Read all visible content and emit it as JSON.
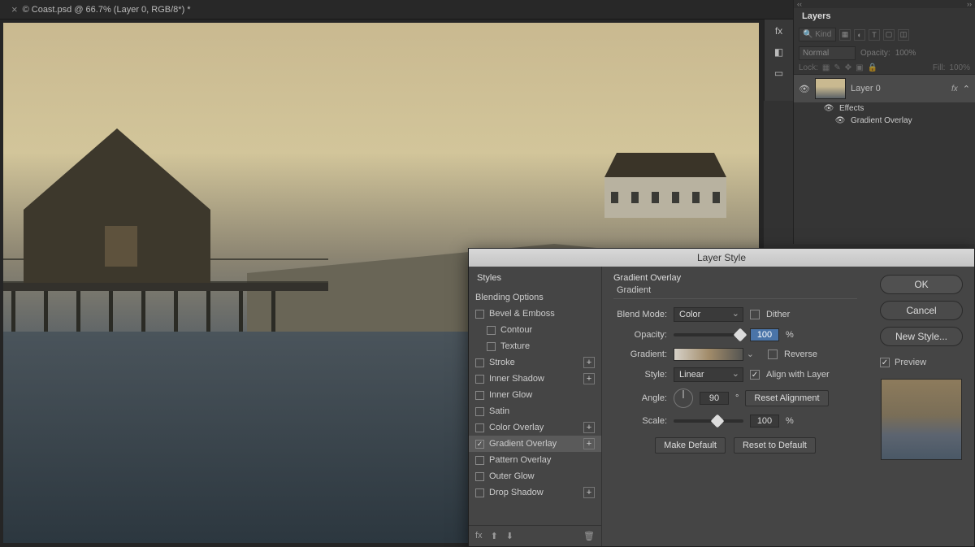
{
  "tab": {
    "title": "© Coast.psd @ 66.7% (Layer 0, RGB/8*) *"
  },
  "layers_panel": {
    "title": "Layers",
    "kind_placeholder": "Kind",
    "blend_mode": "Normal",
    "opacity_label": "Opacity:",
    "opacity_value": "100%",
    "lock_label": "Lock:",
    "fill_label": "Fill:",
    "fill_value": "100%",
    "layer": {
      "name": "Layer 0",
      "fx": "fx",
      "effects": "Effects",
      "gradient_overlay": "Gradient Overlay"
    }
  },
  "dialog": {
    "title": "Layer Style",
    "styles_header": "Styles",
    "blending_options": "Blending Options",
    "bevel_emboss": "Bevel & Emboss",
    "contour": "Contour",
    "texture": "Texture",
    "stroke": "Stroke",
    "inner_shadow": "Inner Shadow",
    "inner_glow": "Inner Glow",
    "satin": "Satin",
    "color_overlay": "Color Overlay",
    "gradient_overlay": "Gradient Overlay",
    "pattern_overlay": "Pattern Overlay",
    "outer_glow": "Outer Glow",
    "drop_shadow": "Drop Shadow",
    "section_title": "Gradient Overlay",
    "section_sub": "Gradient",
    "blend_mode_label": "Blend Mode:",
    "blend_mode_value": "Color",
    "dither": "Dither",
    "opacity_label": "Opacity:",
    "opacity_value": "100",
    "percent": "%",
    "gradient_label": "Gradient:",
    "reverse": "Reverse",
    "style_label": "Style:",
    "style_value": "Linear",
    "align": "Align with Layer",
    "angle_label": "Angle:",
    "angle_value": "90",
    "degree": "°",
    "reset_align": "Reset Alignment",
    "scale_label": "Scale:",
    "scale_value": "100",
    "make_default": "Make Default",
    "reset_default": "Reset to Default",
    "ok": "OK",
    "cancel": "Cancel",
    "new_style": "New Style...",
    "preview": "Preview"
  }
}
